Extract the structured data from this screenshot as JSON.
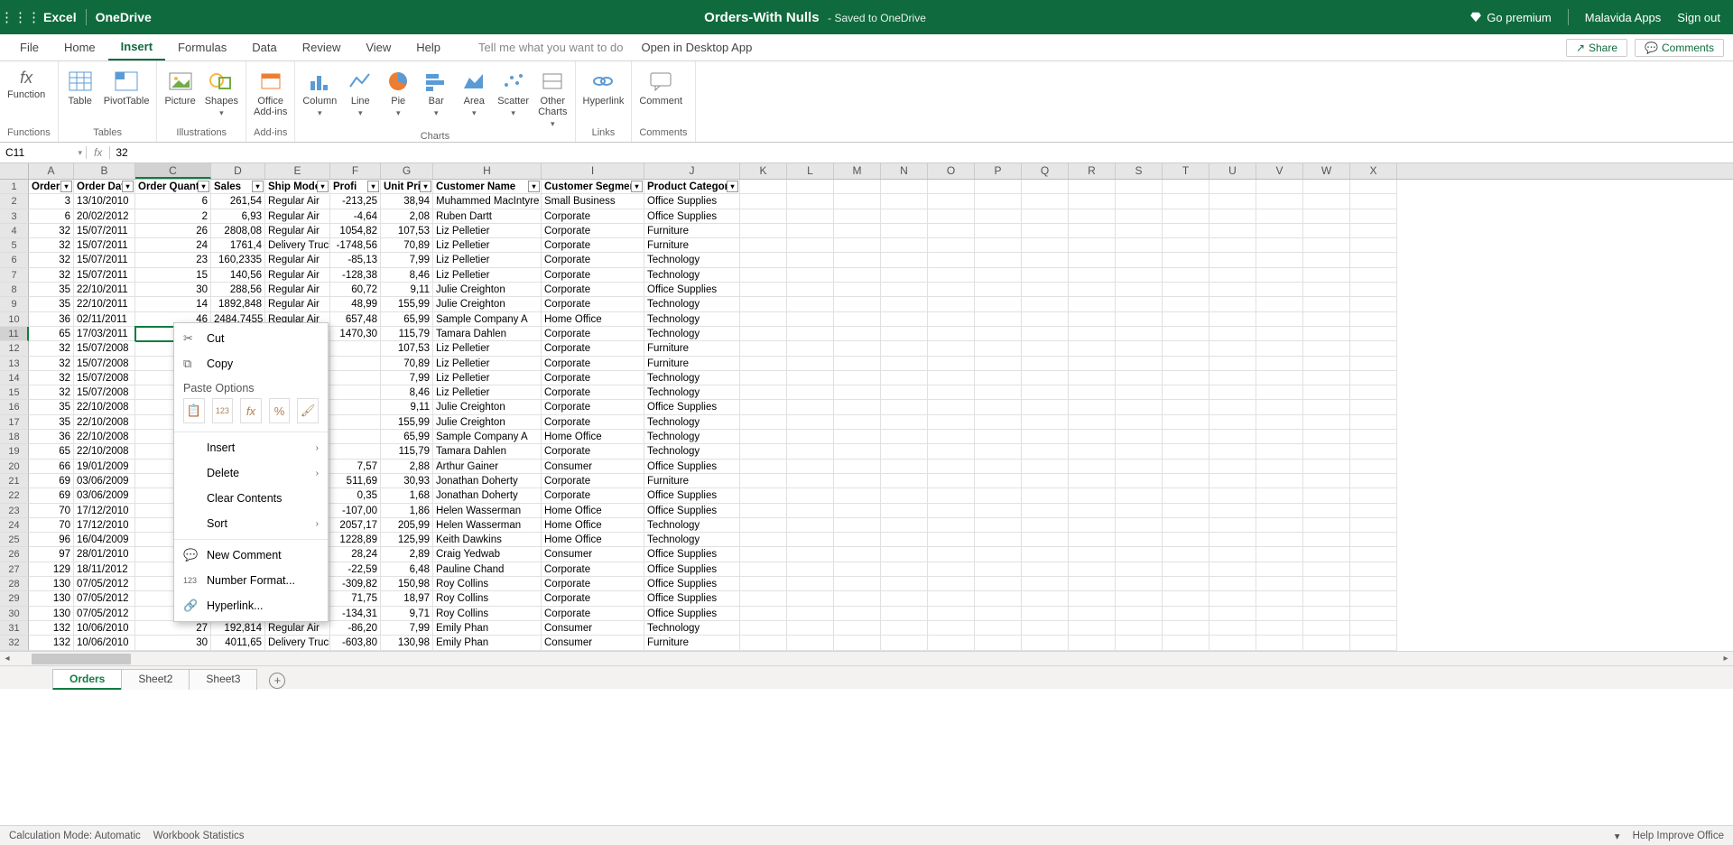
{
  "title_bar": {
    "app": "Excel",
    "service": "OneDrive",
    "doc_title": "Orders-With Nulls",
    "saved_text": "- Saved to OneDrive",
    "go_premium": "Go premium",
    "user": "Malavida Apps",
    "sign_out": "Sign out"
  },
  "ribbon_tabs": [
    "File",
    "Home",
    "Insert",
    "Formulas",
    "Data",
    "Review",
    "View",
    "Help"
  ],
  "ribbon_active": "Insert",
  "tell_me": "Tell me what you want to do",
  "open_desktop": "Open in Desktop App",
  "share_label": "Share",
  "comments_label": "Comments",
  "ribbon_groups": {
    "g1": {
      "label": "Functions",
      "items": [
        {
          "label": "Function"
        }
      ]
    },
    "g2": {
      "label": "Tables",
      "items": [
        {
          "label": "Table"
        },
        {
          "label": "PivotTable"
        }
      ]
    },
    "g3": {
      "label": "Illustrations",
      "items": [
        {
          "label": "Picture"
        },
        {
          "label": "Shapes"
        }
      ]
    },
    "g4": {
      "label": "Add-ins",
      "items": [
        {
          "label": "Office\nAdd-ins"
        }
      ]
    },
    "g5": {
      "label": "Charts",
      "items": [
        {
          "label": "Column"
        },
        {
          "label": "Line"
        },
        {
          "label": "Pie"
        },
        {
          "label": "Bar"
        },
        {
          "label": "Area"
        },
        {
          "label": "Scatter"
        },
        {
          "label": "Other\nCharts"
        }
      ]
    },
    "g6": {
      "label": "Links",
      "items": [
        {
          "label": "Hyperlink"
        }
      ]
    },
    "g7": {
      "label": "Comments",
      "items": [
        {
          "label": "Comment"
        }
      ]
    }
  },
  "name_box": "C11",
  "formula_value": "32",
  "columns": [
    "A",
    "B",
    "C",
    "D",
    "E",
    "F",
    "G",
    "H",
    "I",
    "J",
    "K",
    "L",
    "M",
    "N",
    "O",
    "P",
    "Q",
    "R",
    "S",
    "T",
    "U",
    "V",
    "W",
    "X"
  ],
  "headers": [
    "Order",
    "Order Dat",
    "Order Quantit",
    "Sales",
    "Ship Mode",
    "Profi",
    "Unit Pric",
    "Customer Name",
    "Customer Segmer",
    "Product Categor"
  ],
  "filterable": [
    true,
    true,
    true,
    true,
    true,
    true,
    true,
    true,
    true,
    true
  ],
  "rows": [
    [
      "3",
      "13/10/2010",
      "6",
      "261,54",
      "Regular Air",
      "-213,25",
      "38,94",
      "Muhammed MacIntyre",
      "Small Business",
      "Office Supplies"
    ],
    [
      "6",
      "20/02/2012",
      "2",
      "6,93",
      "Regular Air",
      "-4,64",
      "2,08",
      "Ruben Dartt",
      "Corporate",
      "Office Supplies"
    ],
    [
      "32",
      "15/07/2011",
      "26",
      "2808,08",
      "Regular Air",
      "1054,82",
      "107,53",
      "Liz Pelletier",
      "Corporate",
      "Furniture"
    ],
    [
      "32",
      "15/07/2011",
      "24",
      "1761,4",
      "Delivery Truck",
      "-1748,56",
      "70,89",
      "Liz Pelletier",
      "Corporate",
      "Furniture"
    ],
    [
      "32",
      "15/07/2011",
      "23",
      "160,2335",
      "Regular Air",
      "-85,13",
      "7,99",
      "Liz Pelletier",
      "Corporate",
      "Technology"
    ],
    [
      "32",
      "15/07/2011",
      "15",
      "140,56",
      "Regular Air",
      "-128,38",
      "8,46",
      "Liz Pelletier",
      "Corporate",
      "Technology"
    ],
    [
      "35",
      "22/10/2011",
      "30",
      "288,56",
      "Regular Air",
      "60,72",
      "9,11",
      "Julie Creighton",
      "Corporate",
      "Office Supplies"
    ],
    [
      "35",
      "22/10/2011",
      "14",
      "1892,848",
      "Regular Air",
      "48,99",
      "155,99",
      "Julie Creighton",
      "Corporate",
      "Technology"
    ],
    [
      "36",
      "02/11/2011",
      "46",
      "2484,7455",
      "Regular Air",
      "657,48",
      "65,99",
      "Sample Company A",
      "Home Office",
      "Technology"
    ],
    [
      "65",
      "17/03/2011",
      "",
      "",
      "",
      "1470,30",
      "115,79",
      "Tamara Dahlen",
      "Corporate",
      "Technology"
    ],
    [
      "32",
      "15/07/2008",
      "",
      "",
      "",
      "",
      "107,53",
      "Liz Pelletier",
      "Corporate",
      "Furniture"
    ],
    [
      "32",
      "15/07/2008",
      "",
      "",
      "",
      "",
      "70,89",
      "Liz Pelletier",
      "Corporate",
      "Furniture"
    ],
    [
      "32",
      "15/07/2008",
      "",
      "",
      "",
      "",
      "7,99",
      "Liz Pelletier",
      "Corporate",
      "Technology"
    ],
    [
      "32",
      "15/07/2008",
      "",
      "",
      "",
      "",
      "8,46",
      "Liz Pelletier",
      "Corporate",
      "Technology"
    ],
    [
      "35",
      "22/10/2008",
      "",
      "",
      "",
      "",
      "9,11",
      "Julie Creighton",
      "Corporate",
      "Office Supplies"
    ],
    [
      "35",
      "22/10/2008",
      "",
      "",
      "",
      "",
      "155,99",
      "Julie Creighton",
      "Corporate",
      "Technology"
    ],
    [
      "36",
      "22/10/2008",
      "",
      "",
      "",
      "",
      "65,99",
      "Sample Company A",
      "Home Office",
      "Technology"
    ],
    [
      "65",
      "22/10/2008",
      "",
      "",
      "",
      "",
      "115,79",
      "Tamara Dahlen",
      "Corporate",
      "Technology"
    ],
    [
      "66",
      "19/01/2009",
      "",
      "",
      "",
      "7,57",
      "2,88",
      "Arthur Gainer",
      "Consumer",
      "Office Supplies"
    ],
    [
      "69",
      "03/06/2009",
      "",
      "",
      "",
      "511,69",
      "30,93",
      "Jonathan Doherty",
      "Corporate",
      "Furniture"
    ],
    [
      "69",
      "03/06/2009",
      "",
      "",
      "",
      "0,35",
      "1,68",
      "Jonathan Doherty",
      "Corporate",
      "Office Supplies"
    ],
    [
      "70",
      "17/12/2010",
      "",
      "",
      "",
      "-107,00",
      "1,86",
      "Helen Wasserman",
      "Home Office",
      "Office Supplies"
    ],
    [
      "70",
      "17/12/2010",
      "",
      "",
      "",
      "2057,17",
      "205,99",
      "Helen Wasserman",
      "Home Office",
      "Technology"
    ],
    [
      "96",
      "16/04/2009",
      "",
      "",
      "",
      "1228,89",
      "125,99",
      "Keith Dawkins",
      "Home Office",
      "Technology"
    ],
    [
      "97",
      "28/01/2010",
      "",
      "",
      "",
      "28,24",
      "2,89",
      "Craig Yedwab",
      "Consumer",
      "Office Supplies"
    ],
    [
      "129",
      "18/11/2012",
      "",
      "",
      "",
      "-22,59",
      "6,48",
      "Pauline Chand",
      "Corporate",
      "Office Supplies"
    ],
    [
      "130",
      "07/05/2012",
      "",
      "",
      "",
      "-309,82",
      "150,98",
      "Roy Collins",
      "Corporate",
      "Office Supplies"
    ],
    [
      "130",
      "07/05/2012",
      "",
      "",
      "",
      "71,75",
      "18,97",
      "Roy Collins",
      "Corporate",
      "Office Supplies"
    ],
    [
      "130",
      "07/05/2012",
      "",
      "",
      "",
      "-134,31",
      "9,71",
      "Roy Collins",
      "Corporate",
      "Office Supplies"
    ],
    [
      "132",
      "10/06/2010",
      "27",
      "192,814",
      "Regular Air",
      "-86,20",
      "7,99",
      "Emily Phan",
      "Consumer",
      "Technology"
    ],
    [
      "132",
      "10/06/2010",
      "30",
      "4011,65",
      "Delivery Truck",
      "-603,80",
      "130,98",
      "Emily Phan",
      "Consumer",
      "Furniture"
    ]
  ],
  "selected_cell": {
    "row": 11,
    "col": "C"
  },
  "context_menu": {
    "cut": "Cut",
    "copy": "Copy",
    "paste_heading": "Paste Options",
    "insert": "Insert",
    "delete": "Delete",
    "clear": "Clear Contents",
    "sort": "Sort",
    "new_comment": "New Comment",
    "number_format": "Number Format...",
    "hyperlink": "Hyperlink..."
  },
  "sheets": [
    "Orders",
    "Sheet2",
    "Sheet3"
  ],
  "active_sheet": "Orders",
  "status": {
    "calc": "Calculation Mode: Automatic",
    "wb_stats": "Workbook Statistics",
    "help": "Help Improve Office"
  }
}
